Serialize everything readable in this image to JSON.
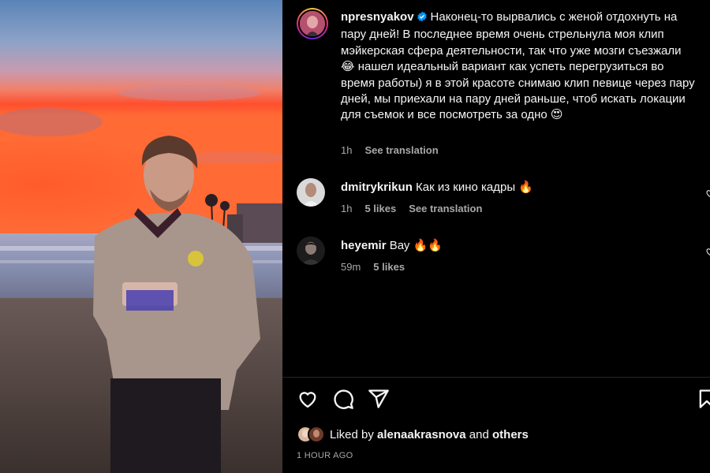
{
  "post": {
    "author": "npresnyakov",
    "caption": "Наконец-то вырвались с женой отдохнуть на пару дней! В последнее время очень стрельнула моя клип мэйкерская сфера деятельности, так что уже мозги съезжали 😂 нашел идеальный вариант как успеть перегрузиться во время работы) я в этой красоте снимаю клип певице через пару дней, мы приехали на пару дней раньше, чтоб искать локации для съемок и все посмотреть за одно 😍",
    "time": "1h",
    "see_translation": "See translation"
  },
  "comments": [
    {
      "user": "dmitrykrikun",
      "text": "Как из кино кадры 🔥",
      "time": "1h",
      "likes": "5 likes",
      "see_translation": "See translation"
    },
    {
      "user": "heyemir",
      "text": "Вау 🔥🔥",
      "time": "59m",
      "likes": "5 likes"
    }
  ],
  "likes": {
    "prefix": "Liked by",
    "user": "alenaakrasnova",
    "and": "and",
    "others": "others"
  },
  "timestamp": "1 HOUR AGO",
  "icons": {
    "like": "heart-icon",
    "comment": "comment-bubble-icon",
    "share": "paper-plane-icon",
    "save": "bookmark-icon",
    "verified": "verified-badge-icon"
  },
  "colors": {
    "background": "#000000",
    "text": "#f5f5f5",
    "secondary": "#a8a8a8",
    "verified": "#0095f6"
  }
}
